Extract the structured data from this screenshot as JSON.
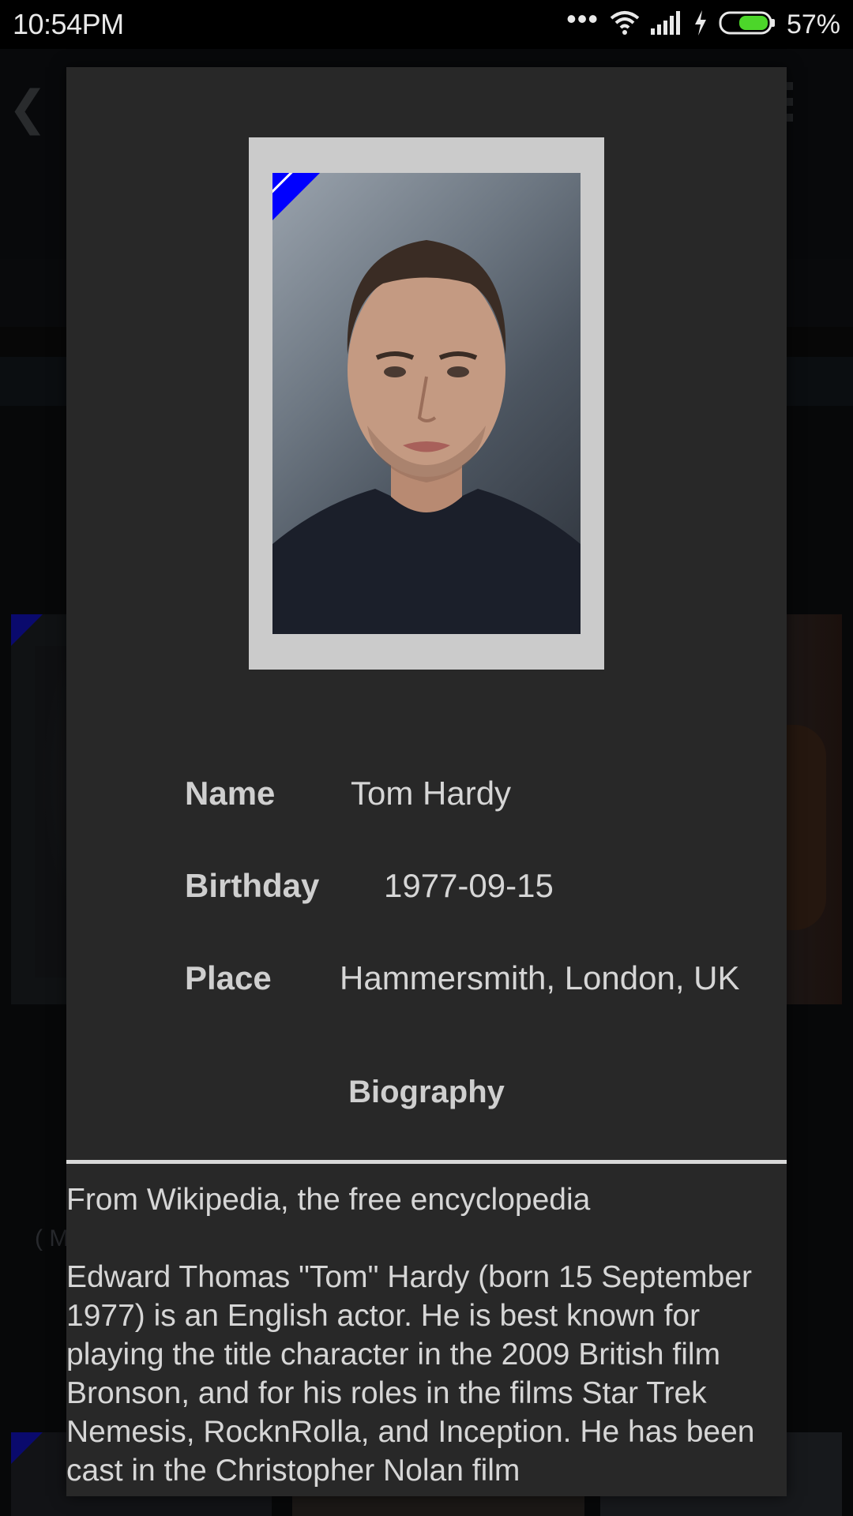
{
  "status_bar": {
    "time": "10:54PM",
    "battery_percent": "57%",
    "icons": [
      "more-dots-icon",
      "wifi-icon",
      "signal-icon",
      "charging-icon",
      "battery-icon"
    ]
  },
  "background": {
    "caption_fragment": "( M"
  },
  "actor": {
    "fields": {
      "name_label": "Name",
      "name_value": "Tom Hardy",
      "birthday_label": "Birthday",
      "birthday_value": "1977-09-15",
      "place_label": "Place",
      "place_value": "Hammersmith, London, UK"
    },
    "biography_heading": "Biography",
    "biography_source": "From Wikipedia, the free encyclopedia",
    "biography_text": "Edward Thomas \"Tom\" Hardy (born 15 September 1977) is an English actor. He is best known for playing the title character in the 2009 British film Bronson, and for his roles in the films Star Trek Nemesis, RocknRolla, and Inception. He has been cast in the Christopher Nolan film"
  },
  "colors": {
    "dialog_bg": "#282828",
    "frame_bg": "#cbcbcb",
    "corner_accent": "#0000ff",
    "battery_fill": "#4cd62a",
    "text_primary": "#d6d6d6"
  }
}
